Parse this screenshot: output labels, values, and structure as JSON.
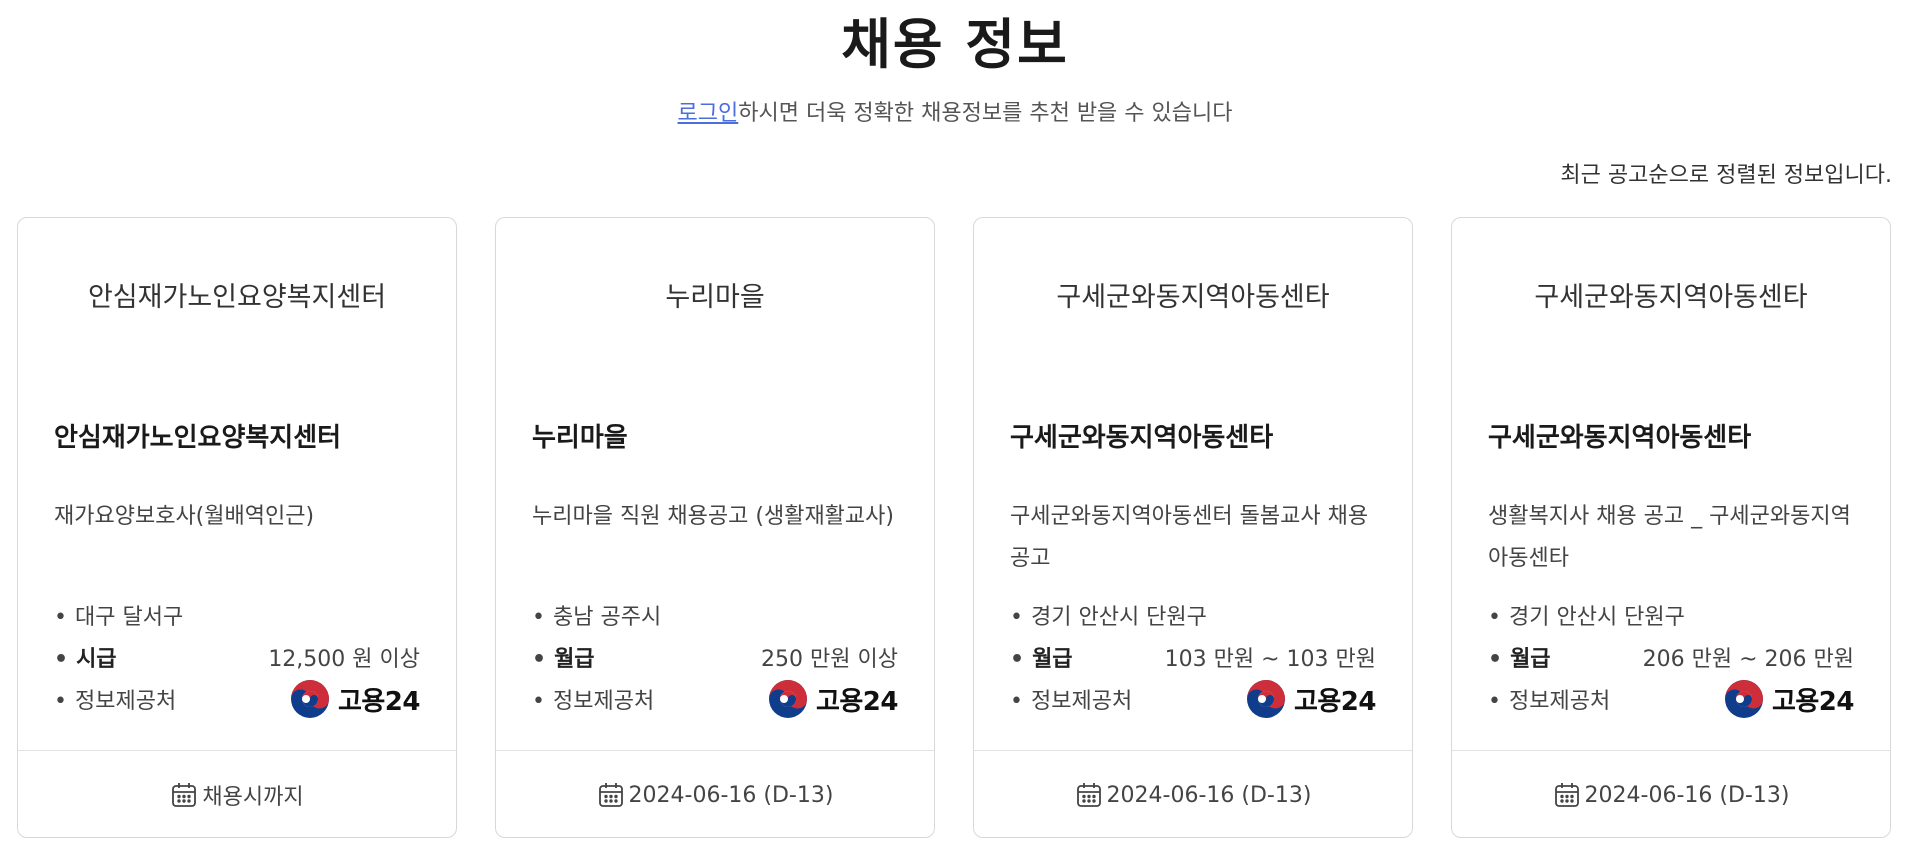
{
  "header": {
    "title": "채용 정보",
    "login_link": "로그인",
    "subtitle_rest": "하시면 더욱 정확한 채용정보를 추천 받을 수 있습니다",
    "sort_note": "최근 공고순으로 정렬된 정보입니다."
  },
  "logo": {
    "text": "고용24",
    "icon": "korea-taegeuk-icon",
    "colors": {
      "red": "#cd2e3a",
      "blue": "#0f3d8c"
    }
  },
  "cards": [
    {
      "header": "안심재가노인요양복지센터",
      "company": "안심재가노인요양복지센터",
      "job_title": "재가요양보호사(월배역인근)",
      "location": "대구 달서구",
      "pay_type": "시급",
      "pay_value": "12,500 원 이상",
      "source_label": "정보제공처",
      "deadline": "채용시까지"
    },
    {
      "header": "누리마을",
      "company": "누리마을",
      "job_title": "누리마을 직원 채용공고 (생활재활교사)",
      "location": "충남 공주시",
      "pay_type": "월급",
      "pay_value": "250 만원 이상",
      "source_label": "정보제공처",
      "deadline": "2024-06-16 (D-13)"
    },
    {
      "header": "구세군와동지역아동센타",
      "company": "구세군와동지역아동센타",
      "job_title": "구세군와동지역아동센터 돌봄교사 채용 공고",
      "location": "경기 안산시 단원구",
      "pay_type": "월급",
      "pay_value": "103 만원 ~ 103 만원",
      "source_label": "정보제공처",
      "deadline": "2024-06-16 (D-13)"
    },
    {
      "header": "구세군와동지역아동센타",
      "company": "구세군와동지역아동센타",
      "job_title": "생활복지사 채용 공고 _ 구세군와동지역아동센타",
      "location": "경기 안산시 단원구",
      "pay_type": "월급",
      "pay_value": "206 만원 ~ 206 만원",
      "source_label": "정보제공처",
      "deadline": "2024-06-16 (D-13)"
    }
  ]
}
